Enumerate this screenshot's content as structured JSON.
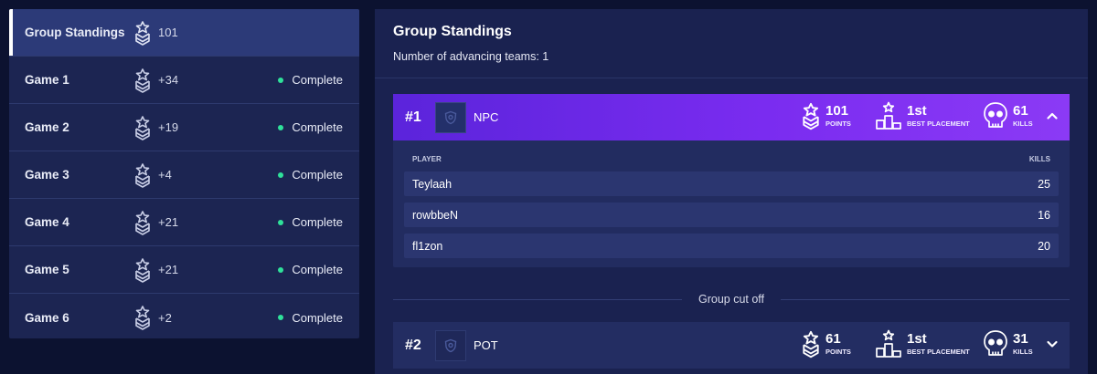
{
  "sidebar": {
    "items": [
      {
        "label": "Group Standings",
        "points": "101",
        "status": "",
        "active": true
      },
      {
        "label": "Game 1",
        "points": "+34",
        "status": "Complete"
      },
      {
        "label": "Game 2",
        "points": "+19",
        "status": "Complete"
      },
      {
        "label": "Game 3",
        "points": "+4",
        "status": "Complete"
      },
      {
        "label": "Game 4",
        "points": "+21",
        "status": "Complete"
      },
      {
        "label": "Game 5",
        "points": "+21",
        "status": "Complete"
      },
      {
        "label": "Game 6",
        "points": "+2",
        "status": "Complete"
      }
    ]
  },
  "main": {
    "title": "Group Standings",
    "subtitle": "Number of advancing teams: 1",
    "cutoff_label": "Group cut off",
    "stat_labels": {
      "points": "POINTS",
      "placement": "BEST PLACEMENT",
      "kills": "KILLS"
    },
    "table_headers": {
      "player": "PLAYER",
      "kills": "KILLS"
    },
    "teams": [
      {
        "rank": "#1",
        "name": "NPC",
        "points": "101",
        "placement": "1st",
        "kills": "61",
        "expanded": true,
        "players": [
          {
            "name": "Teylaah",
            "kills": "25"
          },
          {
            "name": "rowbbeN",
            "kills": "16"
          },
          {
            "name": "fl1zon",
            "kills": "20"
          }
        ]
      },
      {
        "rank": "#2",
        "name": "POT",
        "points": "61",
        "placement": "1st",
        "kills": "31",
        "expanded": false
      }
    ]
  },
  "colors": {
    "background": "#0c1230",
    "panel": "#1a2250",
    "accent_purple": "#7a2cf0",
    "status_complete": "#2fe19a"
  },
  "icons": {
    "points": "chevron-medal-icon",
    "placement": "podium-star-icon",
    "kills": "skull-icon",
    "expand": "chevron-up-icon",
    "collapse": "chevron-down-icon",
    "team_logo": "shield-icon"
  }
}
